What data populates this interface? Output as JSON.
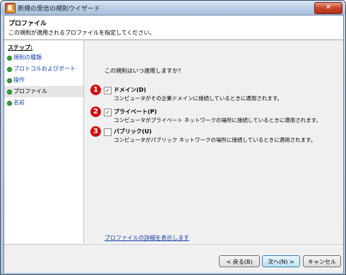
{
  "window": {
    "title": "新規の受信の規則ウイザード",
    "close_glyph": "✕"
  },
  "header": {
    "title": "プロファイル",
    "description": "この規則が適用されるプロファイルを指定してください。"
  },
  "steps": {
    "label": "ステップ:",
    "items": [
      {
        "label": "規則の種類",
        "current": false
      },
      {
        "label": "プロトコルおよびポート",
        "current": false
      },
      {
        "label": "操作",
        "current": false
      },
      {
        "label": "プロファイル",
        "current": true
      },
      {
        "label": "名前",
        "current": false
      }
    ]
  },
  "main": {
    "question": "この規則はいつ適用しますか?",
    "options": [
      {
        "number": "1",
        "label": "ドメイン(D)",
        "checked": true,
        "description": "コンピュータがその企業ドメインに接続しているときに適用されます。"
      },
      {
        "number": "2",
        "label": "プライベート(P)",
        "checked": true,
        "description": "コンピュータがプライベート ネットワークの場所に接続しているときに適用されます。"
      },
      {
        "number": "3",
        "label": "パブリック(U)",
        "checked": false,
        "description": "コンピュータがパブリック ネットワークの場所に接続しているときに適用されます。"
      }
    ],
    "details_link": "プロファイルの詳細を表示します"
  },
  "footer": {
    "back_label": "< 戻る(B)",
    "next_label": "次へ(N) >",
    "cancel_label": "キャンセル"
  },
  "colors": {
    "link": "#1a40a8",
    "marker_red": "#d40d0d",
    "step_bullet": "#3aa23a"
  }
}
